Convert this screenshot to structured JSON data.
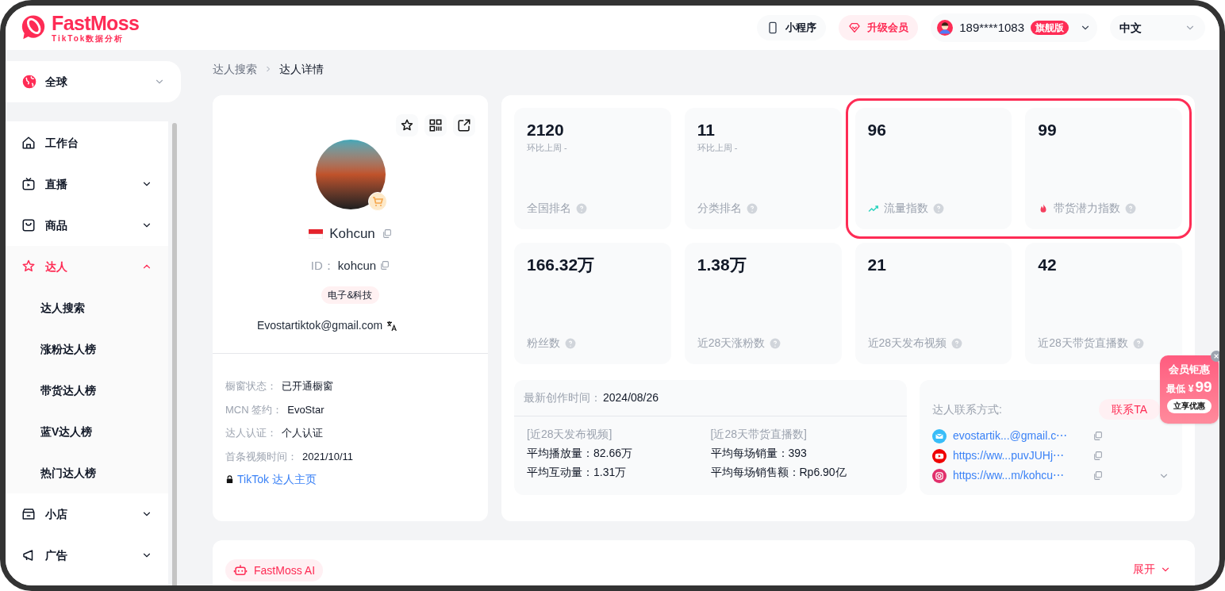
{
  "header": {
    "logo": {
      "name": "FastMoss",
      "subtitle": "TikTok数据分析"
    },
    "mini_program": "小程序",
    "upgrade": "升级会员",
    "account": "189****1083",
    "plan_badge": "旗舰版",
    "language": "中文"
  },
  "sidebar": {
    "region": "全球",
    "items": [
      {
        "label": "工作台",
        "kind": "home",
        "selected": false
      },
      {
        "label": "直播",
        "kind": "live",
        "selected": false,
        "expanded": false
      },
      {
        "label": "商品",
        "kind": "goods",
        "selected": false,
        "expanded": false
      },
      {
        "label": "达人",
        "kind": "creator",
        "selected": true,
        "expanded": true,
        "children": [
          {
            "label": "达人搜索",
            "selected": false
          },
          {
            "label": "涨粉达人榜",
            "selected": false
          },
          {
            "label": "带货达人榜",
            "selected": false
          },
          {
            "label": "蓝V达人榜",
            "selected": false
          },
          {
            "label": "热门达人榜",
            "selected": false
          }
        ]
      },
      {
        "label": "小店",
        "kind": "shop",
        "selected": false,
        "expanded": false
      },
      {
        "label": "广告",
        "kind": "ads",
        "selected": false,
        "expanded": false
      }
    ]
  },
  "breadcrumb": [
    "达人搜索",
    "达人详情"
  ],
  "profile": {
    "name": "Kohcun",
    "id_label": "ID：",
    "id": "kohcun",
    "tag": "电子&科技",
    "email": "Evostartiktok@gmail.com",
    "details": [
      {
        "label": "橱窗状态：",
        "value": "已开通橱窗"
      },
      {
        "label": "MCN 签约：",
        "value": "EvoStar"
      },
      {
        "label": "达人认证：",
        "value": "个人认证"
      },
      {
        "label": "首条视频时间：",
        "value": "2021/10/11"
      }
    ],
    "link": "TikTok 达人主页"
  },
  "stat_groups": [
    {
      "highlighted": false,
      "cards": [
        {
          "value": "2120",
          "compare": "环比上周 -",
          "label": "全国排名",
          "kind": "rank"
        },
        {
          "value": "11",
          "compare": "环比上周 -",
          "label": "分类排名",
          "kind": "rank"
        }
      ]
    },
    {
      "highlighted": true,
      "cards": [
        {
          "value": "96",
          "label": "流量指数",
          "kind": "traffic"
        },
        {
          "value": "99",
          "label": "带货潜力指数",
          "kind": "sales"
        }
      ]
    },
    {
      "highlighted": false,
      "cards": [
        {
          "value": "166.32万",
          "label": "粉丝数",
          "kind": "count"
        },
        {
          "value": "1.38万",
          "label": "近28天涨粉数",
          "kind": "count"
        },
        {
          "value": "21",
          "label": "近28天发布视频",
          "kind": "count"
        },
        {
          "value": "42",
          "label": "近28天带货直播数",
          "kind": "count"
        }
      ]
    }
  ],
  "summary": {
    "latest_label": "最新创作时间：",
    "latest": "2024/08/26",
    "columns": [
      {
        "heading": "[近28天发布视频]",
        "lines": [
          "平均播放量：82.66万",
          "平均互动量：1.31万"
        ]
      },
      {
        "heading": "[近28天带货直播数]",
        "lines": [
          "平均每场销量：393",
          "平均每场销售额：Rp6.90亿"
        ]
      }
    ]
  },
  "contact": {
    "label": "达人联系方式:",
    "button": "联系TA",
    "links": [
      {
        "kind": "email",
        "text": "evostartik...@gmail.c⋯"
      },
      {
        "kind": "youtube",
        "text": "https://ww...puvJUHj⋯"
      },
      {
        "kind": "instagram",
        "text": "https://ww...m/kohcu⋯"
      }
    ]
  },
  "promo": {
    "title": "会员钜惠",
    "price_label": "最低 ¥",
    "price": "99",
    "button": "立享优惠"
  },
  "ai": {
    "label": "FastMoss AI",
    "expand": "展开"
  }
}
